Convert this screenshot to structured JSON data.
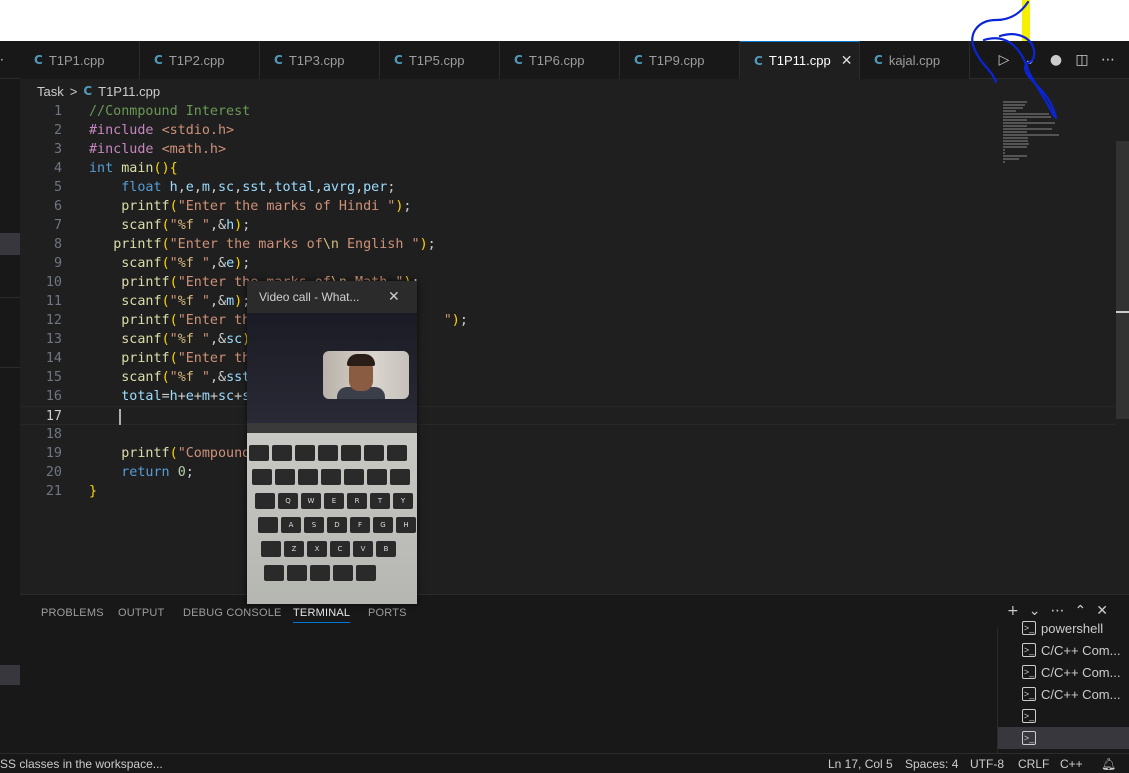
{
  "tabs": [
    {
      "label": "T1P1.cpp",
      "icon": "cpp-file-icon",
      "active": false
    },
    {
      "label": "T1P2.cpp",
      "icon": "cpp-file-icon",
      "active": false
    },
    {
      "label": "T1P3.cpp",
      "icon": "cpp-file-icon",
      "active": false
    },
    {
      "label": "T1P5.cpp",
      "icon": "cpp-file-icon",
      "active": false
    },
    {
      "label": "T1P6.cpp",
      "icon": "cpp-file-icon",
      "active": false
    },
    {
      "label": "T1P9.cpp",
      "icon": "cpp-file-icon",
      "active": false
    },
    {
      "label": "T1P11.cpp",
      "icon": "cpp-file-icon",
      "active": true
    },
    {
      "label": "kajal.cpp",
      "icon": "cpp-file-icon",
      "active": false
    }
  ],
  "tab_icon_glyph": "C",
  "tab_close_glyph": "✕",
  "tabbar_actions": [
    "run-icon",
    "chevron-down-icon",
    "copilot-icon",
    "split-editor-icon",
    "more-icon"
  ],
  "breadcrumb": {
    "folder": "Task",
    "separator": ">",
    "file": "T1P11.cpp"
  },
  "editor": {
    "current_line": 17,
    "lines": [
      {
        "n": "1",
        "text": "//Conmpound Interest"
      },
      {
        "n": "2",
        "text": "#include <stdio.h>"
      },
      {
        "n": "3",
        "text": "#include <math.h>"
      },
      {
        "n": "4",
        "text": "int main(){"
      },
      {
        "n": "5",
        "text": "    float h,e,m,sc,sst,total,avrg,per;"
      },
      {
        "n": "6",
        "text": "    printf(\"Enter the marks of Hindi \");"
      },
      {
        "n": "7",
        "text": "    scanf(\"%f \",&h);"
      },
      {
        "n": "8",
        "text": "   printf(\"Enter the marks of\\n English \");"
      },
      {
        "n": "9",
        "text": "    scanf(\"%f \",&e);"
      },
      {
        "n": "10",
        "text": "    printf(\"Enter the marks of\\n Math \");"
      },
      {
        "n": "11",
        "text": "    scanf(\"%f \",&m);"
      },
      {
        "n": "12",
        "text": "    printf(\"Enter the                       \");"
      },
      {
        "n": "13",
        "text": "    scanf(\"%f \",&sc);"
      },
      {
        "n": "14",
        "text": "    printf(\"Enter the"
      },
      {
        "n": "15",
        "text": "    scanf(\"%f \",&sst);"
      },
      {
        "n": "16",
        "text": "    total=h+e+m+sc+s"
      },
      {
        "n": "17",
        "text": ""
      },
      {
        "n": "18",
        "text": ""
      },
      {
        "n": "19",
        "text": "    printf(\"Compound"
      },
      {
        "n": "20",
        "text": "    return 0;"
      },
      {
        "n": "21",
        "text": "}"
      }
    ]
  },
  "panel": {
    "tabs": [
      {
        "label": "PROBLEMS",
        "active": false
      },
      {
        "label": "OUTPUT",
        "active": false
      },
      {
        "label": "DEBUG CONSOLE",
        "active": false
      },
      {
        "label": "TERMINAL",
        "active": true
      },
      {
        "label": "PORTS",
        "active": false
      }
    ],
    "actions": [
      "plus-icon",
      "chevron-down-icon",
      "more-icon",
      "maximize-icon",
      "close-icon"
    ],
    "terminals": [
      {
        "label": "powershell",
        "selected": false
      },
      {
        "label": "C/C++ Com...",
        "selected": false
      },
      {
        "label": "C/C++ Com...",
        "selected": false
      },
      {
        "label": "C/C++ Com...",
        "selected": false
      },
      {
        "label": "",
        "selected": false
      },
      {
        "label": "",
        "selected": true
      }
    ]
  },
  "statusbar": {
    "left_message": "SS classes in the workspace...",
    "cursor_position": "Ln 17, Col 5",
    "indentation": "Spaces: 4",
    "encoding": "UTF-8",
    "line_ending": "CRLF",
    "language": "C++",
    "notification_icon": "bell-icon"
  },
  "video_call": {
    "title": "Video call - What...",
    "close_glyph": "✕",
    "keyboard_rows": [
      [
        "",
        "",
        "",
        "",
        "",
        "",
        ""
      ],
      [
        "",
        "",
        "",
        "",
        "",
        "",
        ""
      ],
      [
        "",
        "Q",
        "W",
        "E",
        "R",
        "T",
        "Y"
      ],
      [
        "",
        "A",
        "S",
        "D",
        "F",
        "G",
        "H"
      ],
      [
        "",
        "Z",
        "X",
        "C",
        "V",
        "B"
      ],
      [
        "",
        "",
        "",
        "",
        ""
      ]
    ]
  },
  "colors": {
    "editor_bg": "#1f1f1f",
    "tab_bar_bg": "#181818",
    "accent": "#0078d4",
    "keyword": "#569cd6",
    "string": "#ce9178",
    "comment": "#6a9955",
    "function": "#dcdcaa",
    "preprocessor": "#c586c0",
    "number": "#b5cea8",
    "variable": "#9cdcfe",
    "pen_annotation": "#0a24d8",
    "highlight_annotation": "#f6f000"
  }
}
